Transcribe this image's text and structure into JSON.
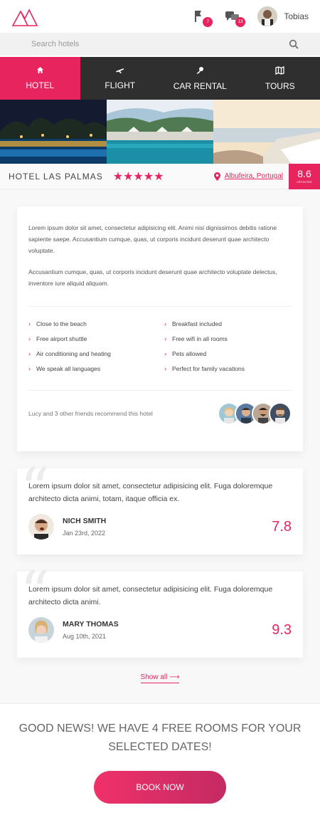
{
  "header": {
    "logo_icon": "mountain-logo-icon",
    "notifications": {
      "icon": "flag-icon",
      "count": "7"
    },
    "messages": {
      "icon": "chat-icon",
      "count": "13"
    },
    "user": {
      "name": "Tobias"
    }
  },
  "search": {
    "placeholder": "Search hotels",
    "icon": "search-icon"
  },
  "tabs": [
    {
      "label": "HOTEL",
      "icon": "home-icon",
      "active": true
    },
    {
      "label": "FLIGHT",
      "icon": "plane-icon",
      "active": false
    },
    {
      "label": "CAR RENTAL",
      "icon": "key-icon",
      "active": false
    },
    {
      "label": "TOURS",
      "icon": "map-icon",
      "active": false
    }
  ],
  "hotel": {
    "name": "HOTEL LAS PALMAS",
    "stars": "★★★★★",
    "star_rating": 5,
    "location": "Albufeira, Portugal",
    "score": "8.6",
    "score_label": "CRYSOTEE"
  },
  "description": {
    "paragraphs": [
      "Lorem ipsum dolor sit amet, consectetur adipisicing elit. Animi nisi dignissimos debitis ratione sapiente saepe. Accusantium cumque, quas, ut corporis incidunt deserunt quae architecto voluptate.",
      "Accusantium cumque, quas, ut corporis incidunt deserunt quae architecto voluptate delectus, inventore iure aliquid aliquam."
    ],
    "features": [
      "Close to the beach",
      "Breakfast included",
      "Free airport shuttle",
      "Free wifi in all rooms",
      "Air conditioning and heating",
      "Pets allowed",
      "We speak all languages",
      "Perfect for family vacations"
    ],
    "friends_text": "Lucy and 3 other friends recommend this hotel"
  },
  "reviews": [
    {
      "text": "Lorem ipsum dolor sit amet, consectetur adipisicing elit. Fuga doloremque architecto dicta animi, totam, itaque officia ex.",
      "name": "NICH SMITH",
      "date": "Jan 23rd, 2022",
      "score": "7.8"
    },
    {
      "text": "Lorem ipsum dolor sit amet, consectetur adipisicing elit. Fuga doloremque architecto dicta animi.",
      "name": "MARY THOMAS",
      "date": "Aug 10th, 2021",
      "score": "9.3"
    }
  ],
  "show_all": "Show all ⟶",
  "bottom": {
    "message": "GOOD NEWS! WE HAVE 4 FREE ROOMS FOR YOUR SELECTED DATES!",
    "button": "BOOK NOW"
  },
  "colors": {
    "accent": "#e8245e",
    "dark_nav": "#2f2f2f"
  }
}
